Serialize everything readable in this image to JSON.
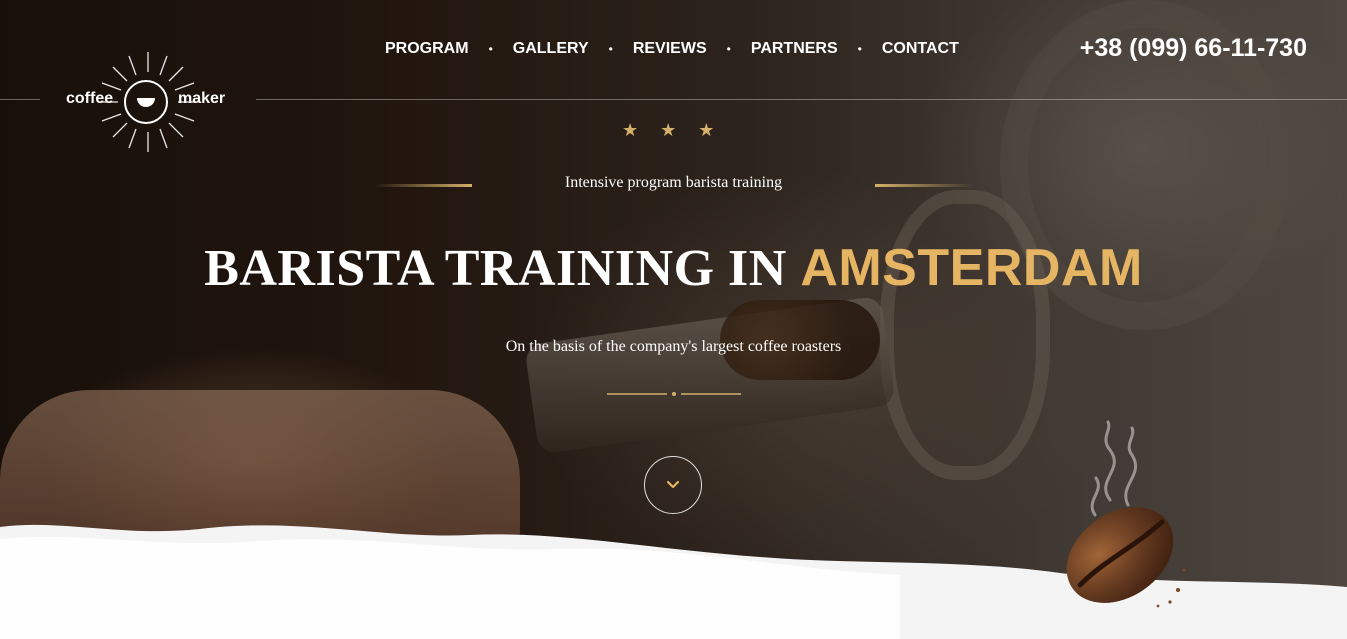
{
  "brand": {
    "word_left": "coffee",
    "word_right": "maker",
    "icon": "coffee-cup-icon"
  },
  "nav": {
    "items": [
      {
        "label": "PROGRAM"
      },
      {
        "label": "GALLERY"
      },
      {
        "label": "REVIEWS"
      },
      {
        "label": "PARTNERS"
      },
      {
        "label": "CONTACT"
      }
    ],
    "separator": "•"
  },
  "phone": "+38 (099) 66-11-730",
  "hero": {
    "stars": "★",
    "subtitle": "Intensive program barista training",
    "title_main": "BARISTA TRAINING IN ",
    "title_accent": "AMSTERDAM",
    "tagline": "On the basis of the company's largest coffee roasters",
    "scroll_icon": "chevron-down-icon"
  },
  "colors": {
    "accent": "#e6b563",
    "gold": "#d5b06b",
    "text": "#ffffff"
  }
}
